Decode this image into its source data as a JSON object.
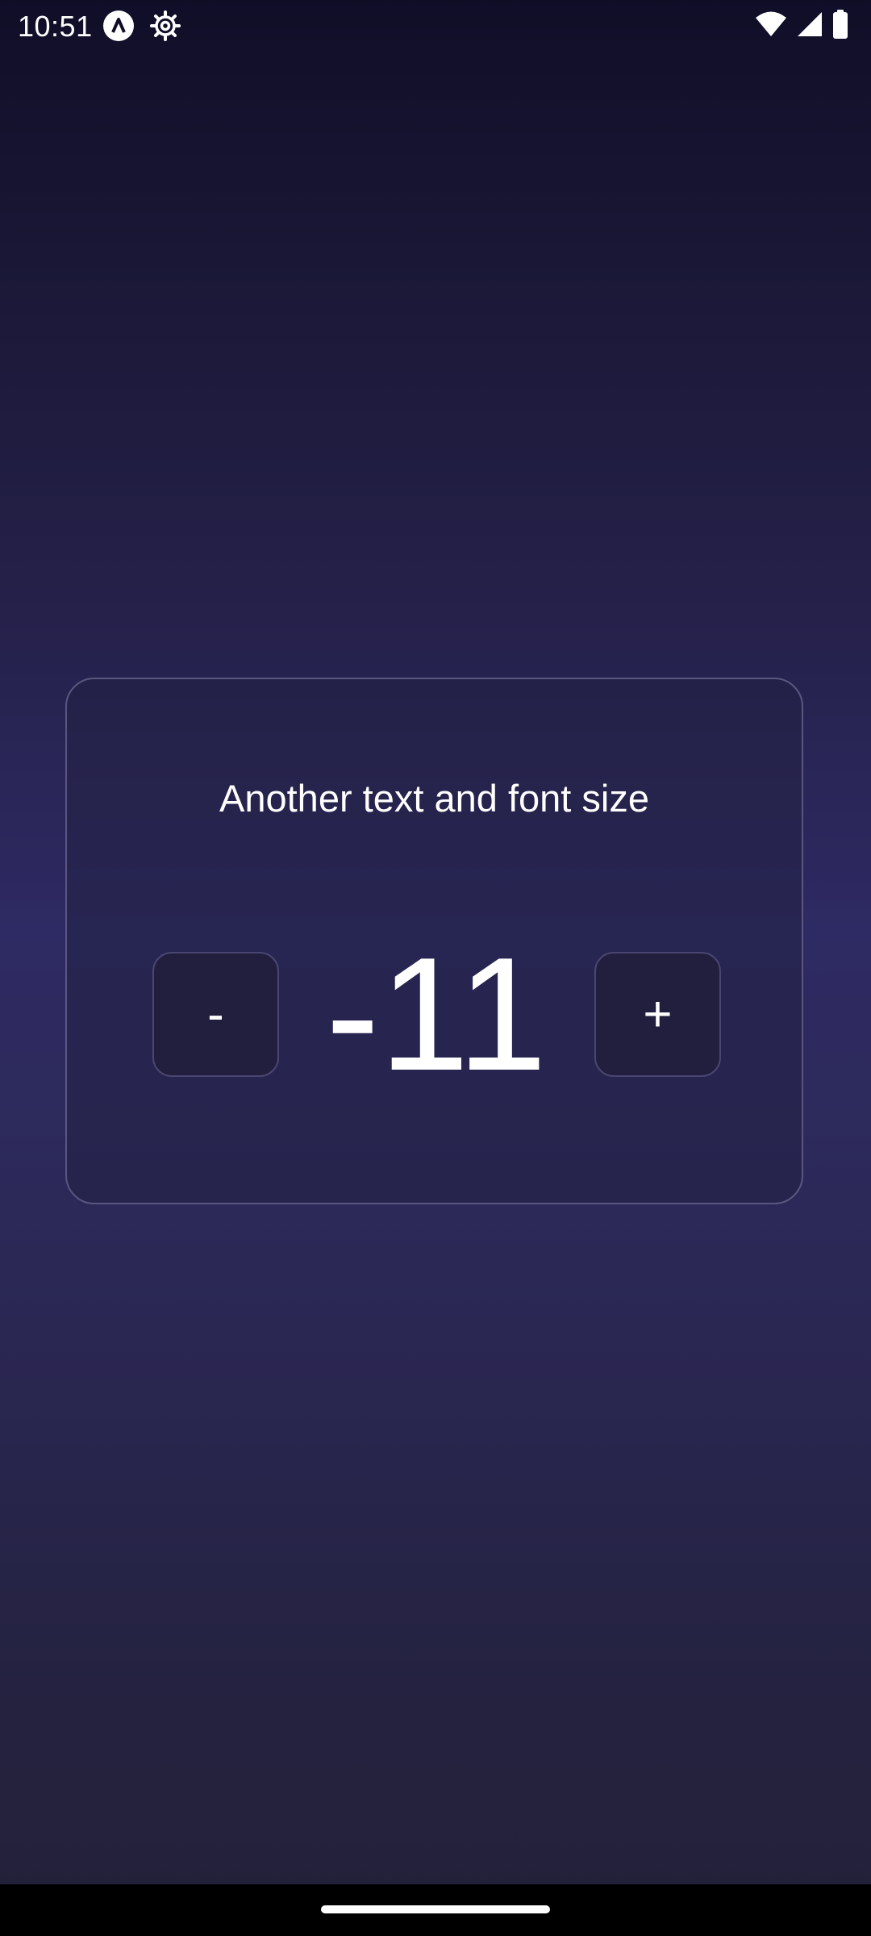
{
  "status_bar": {
    "time": "10:51",
    "icons": [
      "app-notification-icon",
      "settings-gear-icon",
      "wifi-icon",
      "cell-signal-icon",
      "battery-icon"
    ]
  },
  "card": {
    "title": "Another text and font size",
    "minus_label": "-",
    "value": "-11",
    "plus_label": "+"
  },
  "colors": {
    "background_top": "#100e27",
    "background_mid": "#2e2a63",
    "background_bottom": "#232139",
    "card_border": "#5a5680",
    "button_bg": "#211e3e",
    "text": "#ffffff"
  }
}
